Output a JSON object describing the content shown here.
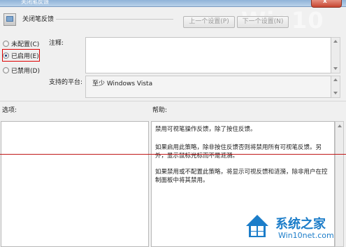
{
  "window": {
    "title": "关闭笔反馈",
    "close_glyph": "x"
  },
  "header": {
    "policy_title": "关闭笔反馈",
    "prev_button": "上一个设置(P)",
    "next_button": "下一个设置(N)",
    "watermark": "Win10"
  },
  "state": {
    "options": [
      {
        "label": "未配置(C)",
        "selected": false
      },
      {
        "label": "已启用(E)",
        "selected": true
      },
      {
        "label": "已禁用(D)",
        "selected": false
      }
    ]
  },
  "comment": {
    "label": "注释:",
    "value": ""
  },
  "platform": {
    "label": "支持的平台:",
    "value": "至少 Windows Vista"
  },
  "options_label": "选项:",
  "help": {
    "label": "帮助:",
    "paragraphs": [
      "禁用可视笔操作反馈，除了按住反馈。",
      "如果启用此策略，除非按住反馈否则将禁用所有可视笔反馈。另外，显示鼠标光标而不是涟漪。",
      "如果禁用或不配置此策略，将显示可视反馈和涟漪，除非用户在控制面板中将其禁用。"
    ]
  },
  "logo": {
    "name": "系统之家",
    "url": "Win10net.com"
  },
  "colors": {
    "highlight_border": "#dd0000",
    "annotation_line": "#c01818",
    "logo_blue": "#1c7dc9"
  }
}
